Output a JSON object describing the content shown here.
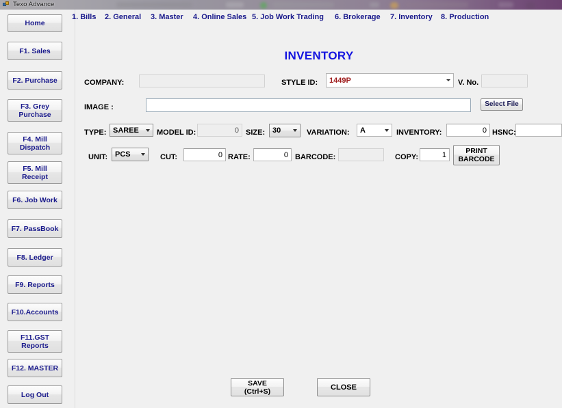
{
  "window": {
    "title": "Texo Advance",
    "icon": "app-window-icon"
  },
  "menu": {
    "items": [
      {
        "label": "1. Bills"
      },
      {
        "label": "2. General"
      },
      {
        "label": "3. Master"
      },
      {
        "label": "4. Online Sales"
      },
      {
        "label": "5. Job Work Trading"
      },
      {
        "label": "6. Brokerage"
      },
      {
        "label": "7. Inventory"
      },
      {
        "label": "8. Production"
      }
    ]
  },
  "sidebar": {
    "items": [
      {
        "label": "Home"
      },
      {
        "label": "F1. Sales"
      },
      {
        "label": "F2. Purchase"
      },
      {
        "label": "F3. Grey\nPurchase"
      },
      {
        "label": "F4. Mill\nDispatch"
      },
      {
        "label": "F5. Mill\nReceipt"
      },
      {
        "label": "F6. Job Work"
      },
      {
        "label": "F7. PassBook"
      },
      {
        "label": "F8. Ledger"
      },
      {
        "label": "F9. Reports"
      },
      {
        "label": "F10.Accounts"
      },
      {
        "label": "F11.GST\nReports"
      },
      {
        "label": "F12. MASTER"
      },
      {
        "label": "Log Out"
      }
    ]
  },
  "form": {
    "title": "INVENTORY",
    "fields": {
      "company": {
        "label": "COMPANY:",
        "value": "",
        "placeholder": ""
      },
      "style_id": {
        "label": "STYLE ID:",
        "value": "1449P",
        "color": "#9e1b1b"
      },
      "v_no": {
        "label": "V. No.",
        "value": "",
        "placeholder": ""
      },
      "image": {
        "label": "IMAGE :",
        "value": "",
        "placeholder": ""
      },
      "select_file": {
        "label": "Select File"
      },
      "type": {
        "label": "TYPE:",
        "value": "SAREE"
      },
      "model_id": {
        "label": "MODEL ID:",
        "value": "0"
      },
      "size": {
        "label": "SIZE:",
        "value": "30"
      },
      "variation": {
        "label": "VARIATION:",
        "value": "A"
      },
      "inventory": {
        "label": "INVENTORY:",
        "value": "0"
      },
      "hsnc": {
        "label": "HSNC:",
        "value": "",
        "placeholder": ""
      },
      "unit": {
        "label": "UNIT:",
        "value": "PCS"
      },
      "cut": {
        "label": "CUT:",
        "value": "0"
      },
      "rate": {
        "label": "RATE:",
        "value": "0"
      },
      "barcode": {
        "label": "BARCODE:",
        "value": "",
        "placeholder": ""
      },
      "copy": {
        "label": "COPY:",
        "value": "1"
      },
      "print_barcode": {
        "label": "PRINT\nBARCODE"
      }
    },
    "actions": {
      "save": {
        "label": "SAVE\n(Ctrl+S)"
      },
      "close": {
        "label": "CLOSE"
      }
    }
  },
  "colors": {
    "menu_text": "#1a1a8c",
    "title_text": "#1515e0",
    "style_id_text": "#9e1b1b",
    "window_bg": "#f0f0f0",
    "titlebar_purple": "#6c4270"
  }
}
